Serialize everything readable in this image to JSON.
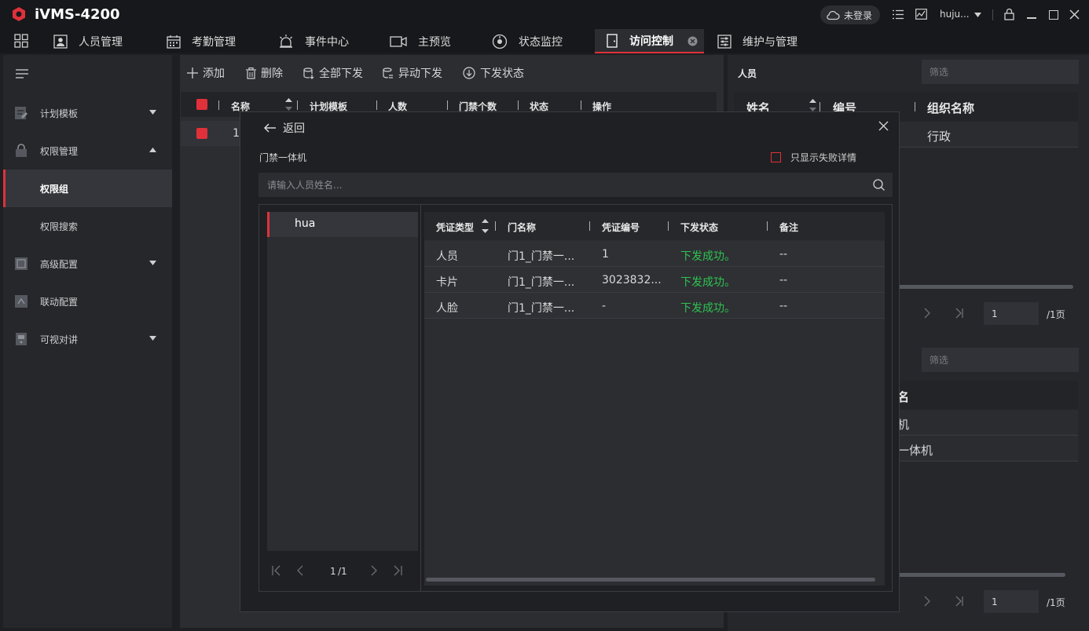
{
  "app": {
    "title": "iVMS-4200",
    "login_status": "未登录",
    "user": "huju..."
  },
  "nav": {
    "tabs": [
      {
        "label": "人员管理",
        "icon": "person-card-icon"
      },
      {
        "label": "考勤管理",
        "icon": "calendar-icon"
      },
      {
        "label": "事件中心",
        "icon": "alarm-icon"
      },
      {
        "label": "主预览",
        "icon": "camera-icon"
      },
      {
        "label": "状态监控",
        "icon": "gauge-icon"
      },
      {
        "label": "访问控制",
        "icon": "door-icon"
      },
      {
        "label": "维护与管理",
        "icon": "settings-panel-icon"
      }
    ],
    "active": "访问控制"
  },
  "sidebar": {
    "items": [
      {
        "label": "计划模板",
        "icon": "template-icon"
      },
      {
        "label": "权限管理",
        "icon": "lock-icon"
      },
      {
        "label": "权限组",
        "icon": ""
      },
      {
        "label": "权限搜索",
        "icon": ""
      },
      {
        "label": "高级配置",
        "icon": "config-icon"
      },
      {
        "label": "联动配置",
        "icon": "linkage-icon"
      },
      {
        "label": "可视对讲",
        "icon": "intercom-icon"
      }
    ]
  },
  "toolbar": {
    "add": "添加",
    "delete": "删除",
    "download_all": "全部下发",
    "download_abnormal": "异动下发",
    "download_status": "下发状态"
  },
  "grid": {
    "columns": [
      "名称",
      "计划模板",
      "人数",
      "门禁个数",
      "状态",
      "操作"
    ],
    "row_first_cell": "1"
  },
  "right_panel": {
    "section1_title": "人员",
    "filter_placeholder": "筛选",
    "columns": [
      "姓名",
      "编号",
      "组织名称"
    ],
    "row1_org": "行政",
    "page_input": "1",
    "page_total": "/1页",
    "section2_filter_placeholder": "筛选",
    "section2_header": "名",
    "section2_rows": [
      "机",
      "一体机"
    ],
    "page_input2": "1",
    "page_total2": "/1页"
  },
  "modal": {
    "back_label": "返回",
    "device_label": "门禁一体机",
    "failed_only_label": "只显示失败详情",
    "search_placeholder": "请输入人员姓名...",
    "person": "hua",
    "pager": {
      "current": "1",
      "total": "/1"
    },
    "table": {
      "columns": [
        "凭证类型",
        "门名称",
        "凭证编号",
        "下发状态",
        "备注"
      ],
      "rows": [
        {
          "type": "人员",
          "door": "门1_门禁一...",
          "number": "1",
          "status": "下发成功。",
          "remark": "--"
        },
        {
          "type": "卡片",
          "door": "门1_门禁一...",
          "number": "3023832...",
          "status": "下发成功。",
          "remark": "--"
        },
        {
          "type": "人脸",
          "door": "门1_门禁一...",
          "number": "-",
          "status": "下发成功。",
          "remark": "--"
        }
      ]
    }
  },
  "colors": {
    "accent": "#e0313a",
    "success": "#2fc24f",
    "background": "#1e1f22"
  }
}
